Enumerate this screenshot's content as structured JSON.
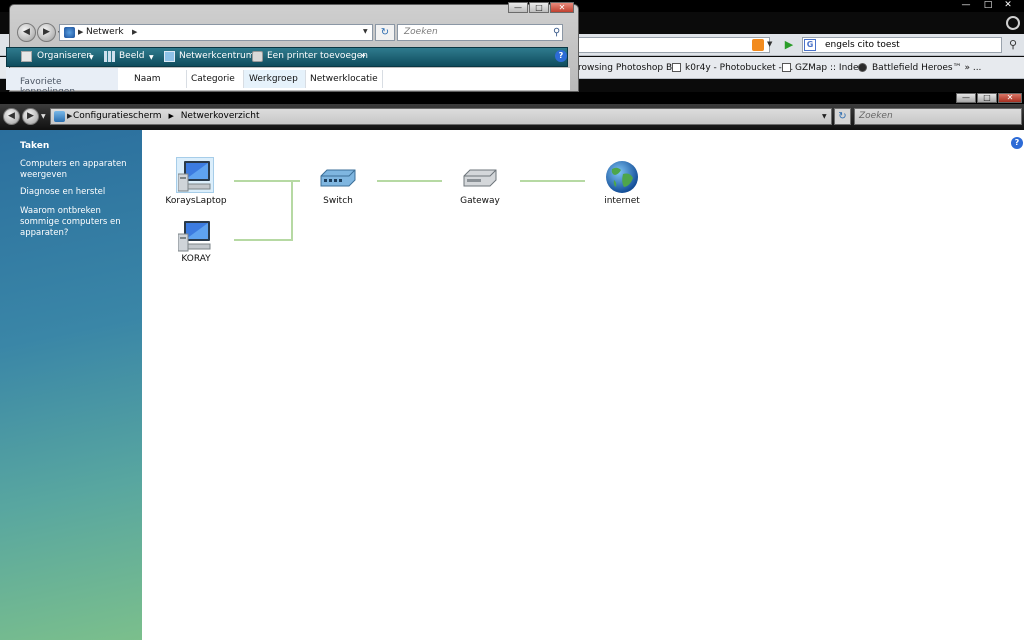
{
  "browser": {
    "search_value": "engels cito toest",
    "bookmarks": [
      "rowsing Photoshop B...",
      "k0r4y - Photobucket - ...",
      "GZMap :: Index",
      "Battlefield Heroes™ » ..."
    ]
  },
  "explorer": {
    "address": "Netwerk",
    "search_placeholder": "Zoeken",
    "toolbar": {
      "organize": "Organiseren",
      "view": "Beeld",
      "network_center": "Netwerkcentrum",
      "add_printer": "Een printer toevoegen",
      "more": "»"
    },
    "favorites_label": "Favoriete koppelingen",
    "columns": [
      "Naam",
      "Categorie",
      "Werkgroep",
      "Netwerklocatie"
    ]
  },
  "network_window": {
    "breadcrumb": [
      "Configuratiescherm",
      "Netwerkoverzicht"
    ],
    "search_placeholder": "Zoeken",
    "sidebar": {
      "title": "Taken",
      "links": [
        "Computers en apparaten weergeven",
        "Diagnose en herstel",
        "Waarom ontbreken sommige computers en apparaten?"
      ]
    },
    "nodes": {
      "laptop": "KoraysLaptop",
      "desktop": "KORAY",
      "switch": "Switch",
      "gateway": "Gateway",
      "internet": "internet"
    }
  },
  "colors": {
    "link_line": "#b6d9a3",
    "sidebar_top": "#2b6f9e",
    "sidebar_bottom": "#7bbf8c",
    "toolbar": "#1f6577"
  }
}
